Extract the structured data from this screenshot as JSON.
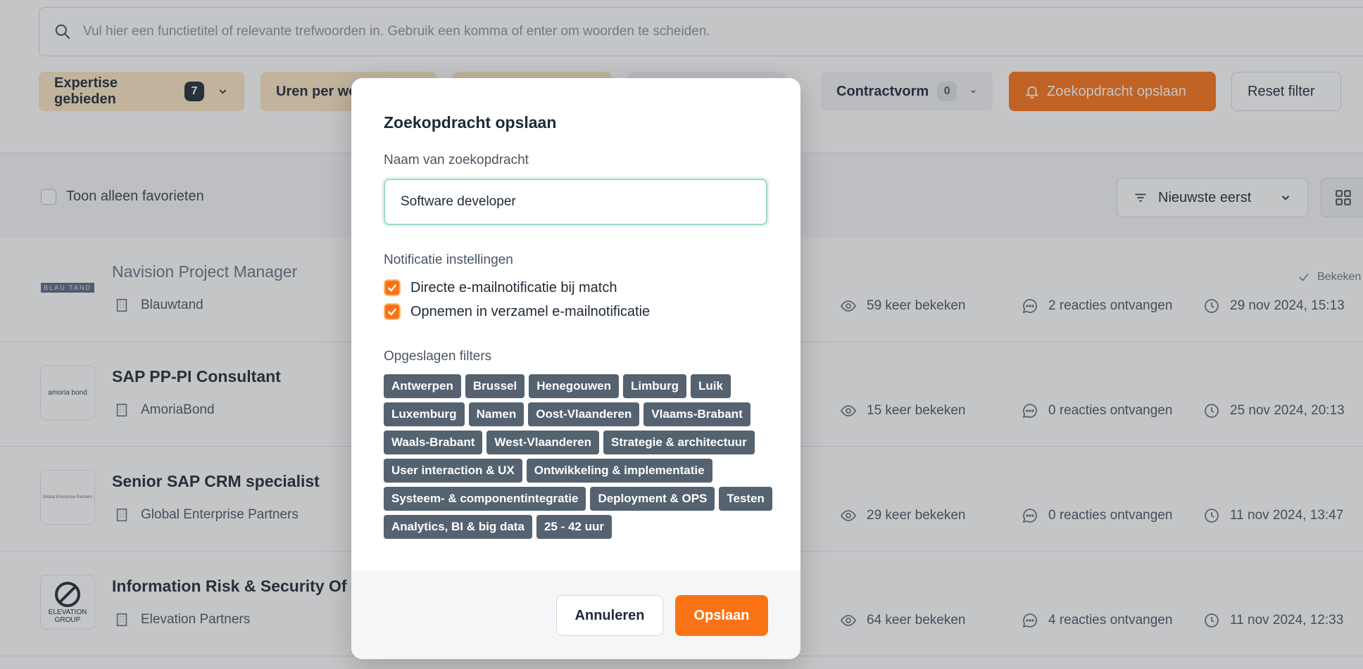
{
  "search": {
    "placeholder": "Vul hier een functietitel of relevante trefwoorden in. Gebruik een komma of enter om woorden te scheiden."
  },
  "filters": {
    "expertise_label": "Expertise gebieden",
    "expertise_count": "7",
    "hours_label": "Uren per we",
    "contract_label": "Contractvorm",
    "contract_count": "0",
    "save_search_label": "Zoekopdracht opslaan",
    "reset_label": "Reset filter"
  },
  "toolbar": {
    "favorites_label": "Toon alleen favorieten",
    "sort_label": "Nieuwste eerst"
  },
  "jobs": [
    {
      "title": "Navision Project Manager",
      "company": "Blauwtand",
      "views": "59 keer bekeken",
      "reactions": "2 reacties ontvangen",
      "date": "29 nov 2024, 15:13",
      "viewed_label": "Bekeken",
      "logo_text": "BLAU TAND"
    },
    {
      "title": "SAP PP-PI Consultant",
      "company": "AmoriaBond",
      "views": "15 keer bekeken",
      "reactions": "0 reacties ontvangen",
      "date": "25 nov 2024, 20:13",
      "logo_text": "amoria bond"
    },
    {
      "title": "Senior SAP CRM specialist",
      "company": "Global Enterprise Partners",
      "views": "29 keer bekeken",
      "reactions": "0 reacties ontvangen",
      "date": "11 nov 2024, 13:47",
      "logo_text": "Global Enterprise Partners"
    },
    {
      "title": "Information Risk & Security Of",
      "company": "Elevation Partners",
      "views": "64 keer bekeken",
      "reactions": "4 reacties ontvangen",
      "date": "11 nov 2024, 12:33",
      "logo_text": "ELEVATION GROUP"
    }
  ],
  "modal": {
    "title": "Zoekopdracht opslaan",
    "name_label": "Naam van zoekopdracht",
    "name_value": "Software developer",
    "notification_label": "Notificatie instellingen",
    "option_direct": "Directe e-mailnotificatie bij match",
    "option_digest": "Opnemen in verzamel e-mailnotificatie",
    "filters_label": "Opgeslagen filters",
    "tag_lines": [
      [
        "Antwerpen",
        "Brussel",
        "Henegouwen",
        "Limburg",
        "Luik"
      ],
      [
        "Luxemburg",
        "Namen",
        "Oost-Vlaanderen",
        "Vlaams-Brabant"
      ],
      [
        "Waals-Brabant",
        "West-Vlaanderen",
        "Strategie & architectuur"
      ],
      [
        "User interaction & UX",
        "Ontwikkeling & implementatie"
      ],
      [
        "Systeem- & componentintegratie",
        "Deployment & OPS",
        "Testen"
      ],
      [
        "Analytics, BI & big data",
        "25 - 42 uur"
      ]
    ],
    "cancel_label": "Annuleren",
    "save_label": "Opslaan"
  },
  "colors": {
    "accent": "#f97316",
    "tag": "#556270",
    "chip_tan": "#fbe6c2"
  }
}
